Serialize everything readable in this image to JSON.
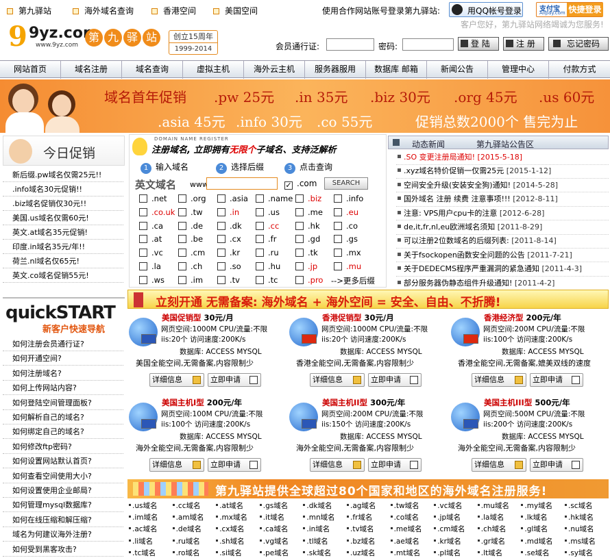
{
  "top_links": [
    "第九驿站",
    "海外域名查询",
    "香港空间",
    "美国空间"
  ],
  "partner_text": "使用合作网站账号登录第九驿站:",
  "qq_login": "用QQ帐号登录",
  "alipay_logo": "支付宝",
  "alipay_sub": "Alipay.com",
  "alipay_login": "快捷登录",
  "welcome": "客户您好，第九驿站网络竭诚为您服务!",
  "logo": {
    "main": "9yz.com",
    "url": "www.9yz.com",
    "chars": [
      "第",
      "九",
      "驿",
      "站"
    ],
    "anniv": "创立15周年",
    "years": "1999-2014"
  },
  "login": {
    "user_label": "会员通行证:",
    "pass_label": "密码:",
    "login_btn": "登 陆",
    "register_btn": "注 册",
    "forgot_btn": "忘记密码"
  },
  "nav": [
    "网站首页",
    "域名注册",
    "域名查询",
    "虚拟主机",
    "海外云主机",
    "服务器服用",
    "数据库 邮箱",
    "新闻公告",
    "管理中心",
    "付款方式"
  ],
  "banner": {
    "line1": [
      "域名首年促销",
      ".pw 25元",
      ".in 35元",
      ".biz 30元",
      ".org 45元",
      ".us 60元"
    ],
    "line2": [
      ".asia 45元",
      ".info 30元",
      ".co 55元",
      "促销总数2000个 售完为止"
    ]
  },
  "promo_title": "今日促销",
  "promos": [
    "新后缀.pw域名仅需25元!!",
    ".info域名30元促销!!",
    ".biz域名促销仅30元!!",
    "美国.us域名仅需60元!",
    "英文.at域名35元促销!",
    "印度.in域名35元/年!!",
    "荷兰.nl域名仅65元!",
    "英文.co域名促销55元!"
  ],
  "quickstart": {
    "title": "quickSTART",
    "sub": "新客户快速导航"
  },
  "guide": [
    "如何注册会员通行证?",
    "如何开通空间?",
    "如何注册域名?",
    "如何上传网站内容?",
    "如何登陆空间管理面板?",
    "如何解析自己的域名?",
    "如何绑定自己的域名?",
    "如何修改ftp密码?",
    "如何设置网站默认首页?",
    "如何查看空间使用大小?",
    "如何设置使用企业邮局?",
    "如何管理mysql数据库?",
    "如何在线压缩和解压缩?",
    "域名为何建议海外注册?",
    "如何受到黑客攻击?"
  ],
  "register": {
    "small": "DOMAIN NAME REGISTER",
    "headline_a": "注册域名, 立即拥有",
    "headline_b": "无限个",
    "headline_c": "子域名、支持泛解析",
    "steps": [
      "输入域名",
      "选择后缀",
      "点击查询"
    ],
    "en_label": "英文域名",
    "www": "www.",
    "selected": ".com",
    "search_btn": "SEARCH",
    "more": "-->更多后缀",
    "rows": [
      [
        ".net",
        ".org",
        ".asia",
        ".name",
        ".biz",
        ".info"
      ],
      [
        ".co.uk",
        ".tw",
        ".in",
        ".us",
        ".me",
        ".eu"
      ],
      [
        ".ca",
        ".de",
        ".dk",
        ".cc",
        ".hk",
        ".co"
      ],
      [
        ".at",
        ".be",
        ".cx",
        ".fr",
        ".gd",
        ".gs"
      ],
      [
        ".vc",
        ".cm",
        ".kr",
        ".ru",
        ".tk",
        ".mx"
      ],
      [
        ".la",
        ".ch",
        ".so",
        ".hu",
        ".jp",
        ".mu"
      ],
      [
        ".ws",
        ".im",
        ".tv",
        ".tc",
        ".pro"
      ]
    ],
    "red": [
      ".biz",
      ".co.uk",
      ".in",
      ".eu",
      ".cc",
      ".jp",
      ".mu",
      ".pro"
    ]
  },
  "news_tabs": [
    "动态新闻",
    "第九驿站公告区"
  ],
  "news": [
    {
      "t": ".SO 变更注册局通知!",
      "d": "[2015-5-18]",
      "red": true
    },
    {
      "t": ".xyz域名特价促销一仅需25元",
      "d": "[2015-1-12]"
    },
    {
      "t": "空间安全升级(安装安全狗)通知!",
      "d": "[2014-5-28]"
    },
    {
      "t": "国外域名 注册 续费 注意事项!!!",
      "d": "[2012-8-11]"
    },
    {
      "t": "注意: VPS用户cpu卡的注意",
      "d": "[2012-6-28]"
    },
    {
      "t": "de,it,fr,nl,eu欧洲域名须知",
      "d": "[2011-8-29]"
    },
    {
      "t": "可以注册2位数域名的后缀列表:",
      "d": "[2011-8-14]"
    },
    {
      "t": "关于fsockopen函数安全问题的公告",
      "d": "[2011-7-21]"
    },
    {
      "t": "关于DEDECMS程序严重漏洞的紧急通知",
      "d": "[2011-4-3]"
    },
    {
      "t": "部分服务器伪静态组件升级通知!",
      "d": "[2011-4-2]"
    }
  ],
  "hosting_banner": "立刻开通 无需备案: 海外域名 + 海外空间 = 安全、自由、不折腾!",
  "cards": [
    {
      "name": "美国促销型",
      "price": "30元/月",
      "l1": "网页空间:1000M CPU/流量:不限",
      "l2": "iis:20个 访问速度:200K/s",
      "l3": "数据库: ACCESS MYSQL",
      "foot": "美国全能空间,无需备案,内容限制少"
    },
    {
      "name": "香港促销型",
      "price": "30元/月",
      "l1": "网页空间:1000M CPU/流量:不限",
      "l2": "iis:20个 访问速度:200K/s",
      "l3": "数据库: ACCESS MYSQL",
      "foot": "香港全能空间,无需备案,内容限制少"
    },
    {
      "name": "香港经济型",
      "price": "200元/年",
      "l1": "网页空间:200M CPU/流量:不限",
      "l2": "iis:100个 访问速度:200K/s",
      "l3": "数据库: ACCESS MYSQL",
      "foot": "香港全能空间,无需备案,媲美双线的速度"
    },
    {
      "name": "美国主机I型",
      "price": "200元/年",
      "l1": "网页空间:100M CPU/流量:不限",
      "l2": "iis:100个 访问速度:200K/s",
      "l3": "数据库: ACCESS MYSQL",
      "foot": "海外全能空间,无需备案,内容限制少"
    },
    {
      "name": "美国主机II型",
      "price": "300元/年",
      "l1": "网页空间:200M CPU/流量:不限",
      "l2": "iis:150个 访问速度:200K/s",
      "l3": "数据库: ACCESS MYSQL",
      "foot": "海外全能空间,无需备案,内容限制少"
    },
    {
      "name": "美国主机III型",
      "price": "500元/年",
      "l1": "网页空间:500M CPU/流量:不限",
      "l2": "iis:200个 访问速度:200K/s",
      "l3": "数据库: ACCESS MYSQL",
      "foot": "海外全能空间,无需备案,内容限制少"
    }
  ],
  "detail_btn": "详细信息",
  "apply_btn": "立即申请",
  "domain_banner": "第九驿站提供全球超过80个国家和地区的海外域名注册服务!",
  "domain_list": [
    [
      ".us域名",
      ".cc域名",
      ".at域名",
      ".gs域名",
      ".dk域名",
      ".ag域名",
      ".tw域名",
      ".vc域名",
      ".mu域名",
      ".my域名",
      ".sc域名"
    ],
    [
      ".im域名",
      ".am域名",
      ".mx域名",
      ".it域名",
      ".mn域名",
      ".fr域名",
      ".co域名",
      ".jp域名",
      ".la域名",
      ".lk域名",
      ".hk域名"
    ],
    [
      ".ac域名",
      ".de域名",
      ".cx域名",
      ".ca域名",
      ".in域名",
      ".tv域名",
      ".me域名",
      ".cm域名",
      ".ch域名",
      ".gl域名",
      ".nu域名"
    ],
    [
      ".li域名",
      ".ru域名",
      ".sh域名",
      ".vg域名",
      ".tl域名",
      ".bz域名",
      ".ae域名",
      ".kr域名",
      ".gr域名",
      ".md域名",
      ".ms域名"
    ],
    [
      ".tc域名",
      ".ro域名",
      ".si域名",
      ".pe域名",
      ".sk域名",
      ".uz域名",
      ".mt域名",
      ".pl域名",
      ".lt域名",
      ".se域名",
      ".sy域名"
    ]
  ]
}
